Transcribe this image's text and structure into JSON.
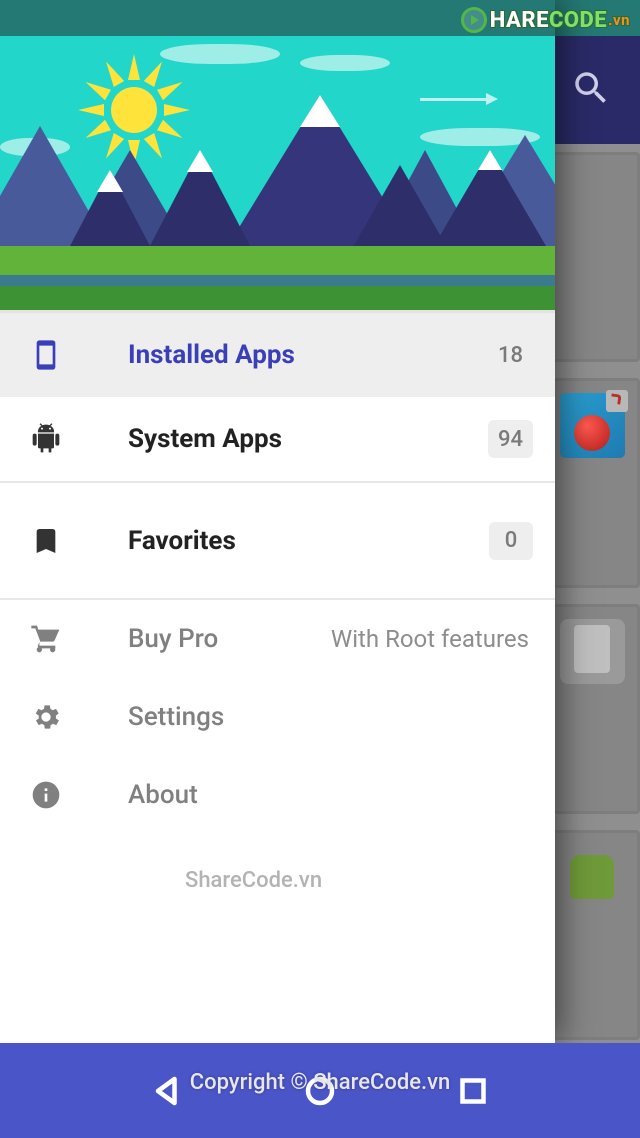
{
  "statusbar": {},
  "appbar": {
    "search_icon": "search-icon"
  },
  "drawer": {
    "items": [
      {
        "icon": "phone-icon",
        "label": "Installed Apps",
        "badge": "18"
      },
      {
        "icon": "android-icon",
        "label": "System Apps",
        "badge": "94"
      },
      {
        "icon": "bookmark-icon",
        "label": "Favorites",
        "badge": "0"
      }
    ],
    "secondary": [
      {
        "icon": "cart-icon",
        "label": "Buy Pro",
        "subtitle": "With Root features"
      },
      {
        "icon": "gear-icon",
        "label": "Settings"
      },
      {
        "icon": "info-icon",
        "label": "About"
      }
    ]
  },
  "watermarks": {
    "logo_text_a": "HARE",
    "logo_text_b": "CODE",
    "logo_suffix": ".vn",
    "mid": "ShareCode.vn",
    "footer": "Copyright © ShareCode.vn"
  }
}
